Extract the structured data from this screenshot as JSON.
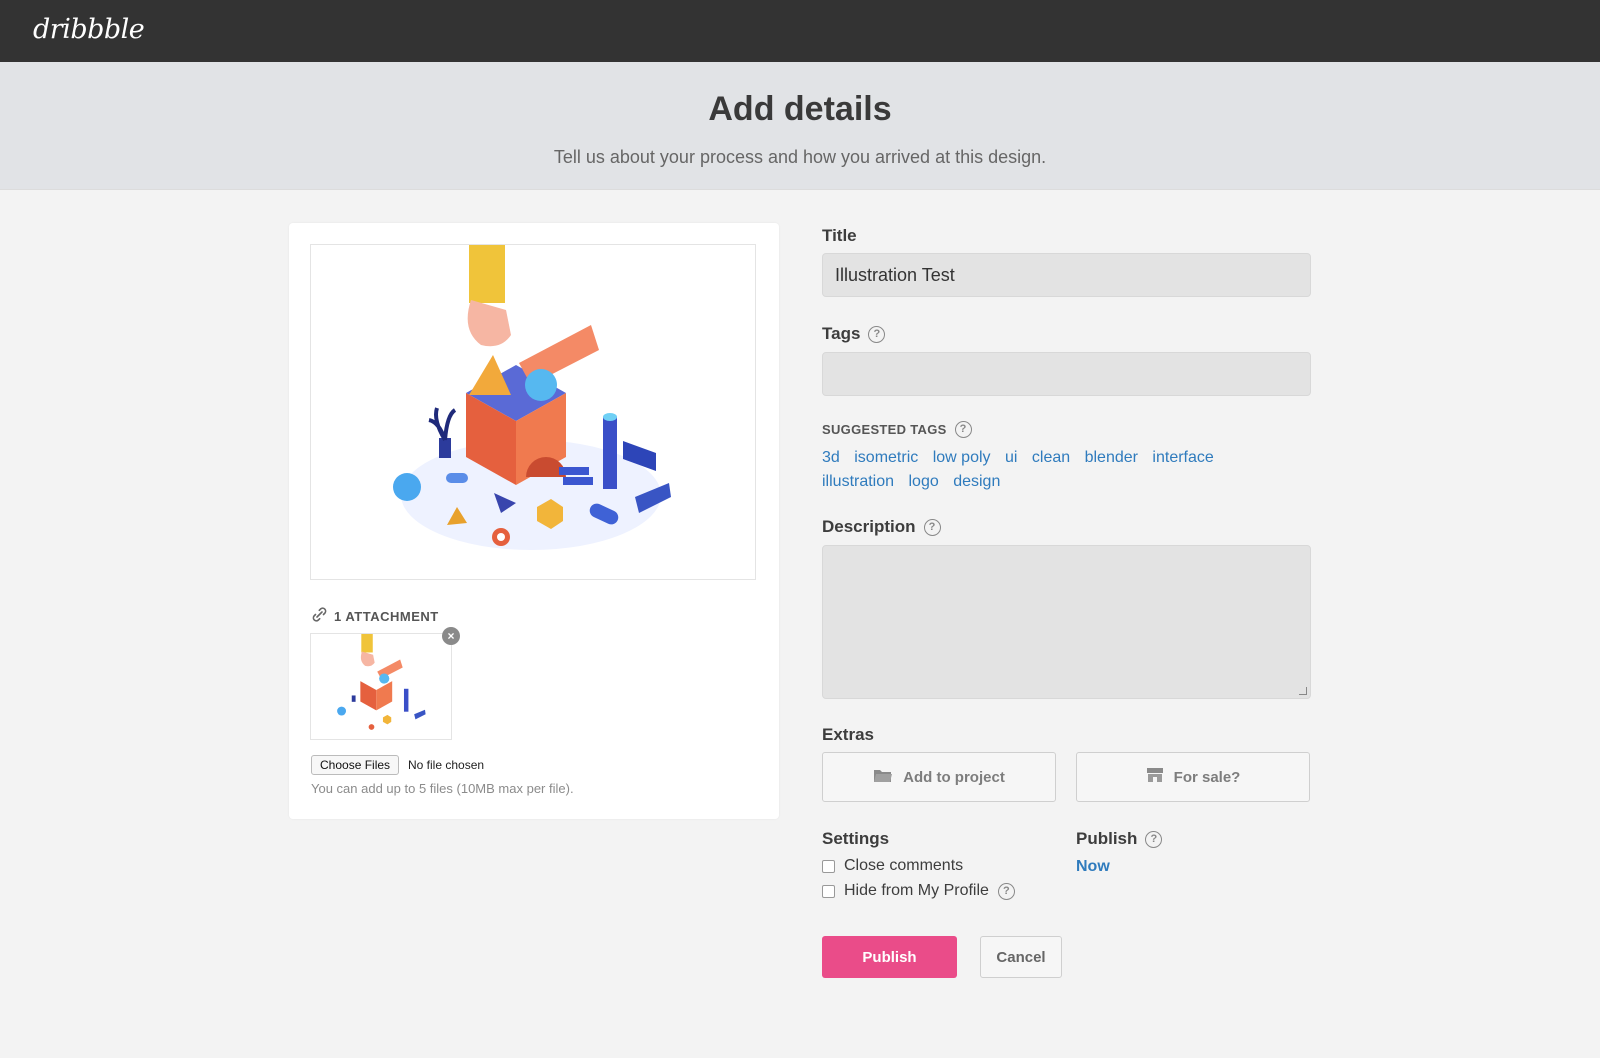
{
  "app": {
    "logo": "dribbble"
  },
  "hero": {
    "title": "Add details",
    "subtitle": "Tell us about your process and how you arrived at this design."
  },
  "attachments": {
    "header": "1 ATTACHMENT",
    "choose_label": "Choose Files",
    "no_file": "No file chosen",
    "hint": "You can add up to 5 files (10MB max per file)."
  },
  "form": {
    "title_label": "Title",
    "title_value": "Illustration Test",
    "tags_label": "Tags",
    "tags_value": "",
    "suggested_label": "SUGGESTED TAGS",
    "suggested_tags": [
      "3d",
      "isometric",
      "low poly",
      "ui",
      "clean",
      "blender",
      "interface",
      "illustration",
      "logo",
      "design"
    ],
    "description_label": "Description",
    "description_value": "",
    "extras_label": "Extras",
    "add_to_project": "Add to project",
    "for_sale": "For sale?",
    "settings_label": "Settings",
    "close_comments": "Close comments",
    "hide_profile": "Hide from My Profile",
    "publish_label": "Publish",
    "publish_when": "Now",
    "publish_button": "Publish",
    "cancel_button": "Cancel"
  },
  "colors": {
    "accent": "#ea4c89",
    "link": "#2f7bbd",
    "topbar": "#333333"
  }
}
